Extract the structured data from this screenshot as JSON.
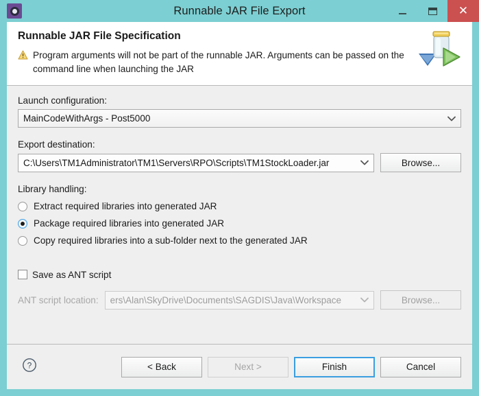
{
  "window": {
    "title": "Runnable JAR File Export",
    "app_icon": "gear-icon",
    "controls": {
      "minimize": "minimize-icon",
      "maximize": "maximize-icon",
      "close": "✕"
    },
    "titlebar_color": "#7ccfd2",
    "close_color": "#cb5050"
  },
  "header": {
    "title": "Runnable JAR File Specification",
    "warning_icon": "warning-triangle-icon",
    "warning_text": "Program arguments will not be part of the runnable JAR. Arguments can be passed on the command line when launching the JAR",
    "banner_icon": "runnable-jar-icon"
  },
  "launch_configuration": {
    "label": "Launch configuration:",
    "value": "MainCodeWithArgs - Post5000",
    "dropdown_icon": "chevron-down-icon"
  },
  "export_destination": {
    "label": "Export destination:",
    "value": "C:\\Users\\TM1Administrator\\TM1\\Servers\\RPO\\Scripts\\TM1StockLoader.jar",
    "dropdown_icon": "chevron-down-icon",
    "browse_label": "Browse..."
  },
  "library_handling": {
    "label": "Library handling:",
    "options": [
      {
        "label": "Extract required libraries into generated JAR",
        "selected": false
      },
      {
        "label": "Package required libraries into generated JAR",
        "selected": true
      },
      {
        "label": "Copy required libraries into a sub-folder next to the generated JAR",
        "selected": false
      }
    ]
  },
  "ant_script": {
    "checkbox_label": "Save as ANT script",
    "checked": false,
    "location_label": "ANT script location:",
    "location_value": "ers\\Alan\\SkyDrive\\Documents\\SAGDIS\\Java\\Workspace",
    "dropdown_icon": "chevron-down-icon",
    "browse_label": "Browse...",
    "enabled": false
  },
  "footer": {
    "help_icon": "help-circle-icon",
    "buttons": [
      {
        "label": "< Back",
        "state": "enabled"
      },
      {
        "label": "Next >",
        "state": "disabled"
      },
      {
        "label": "Finish",
        "state": "focused"
      },
      {
        "label": "Cancel",
        "state": "enabled"
      }
    ]
  },
  "colors": {
    "accent": "#7ccfd2",
    "focus": "#3a9ee0",
    "panel": "#efefef",
    "close": "#cb5050"
  }
}
